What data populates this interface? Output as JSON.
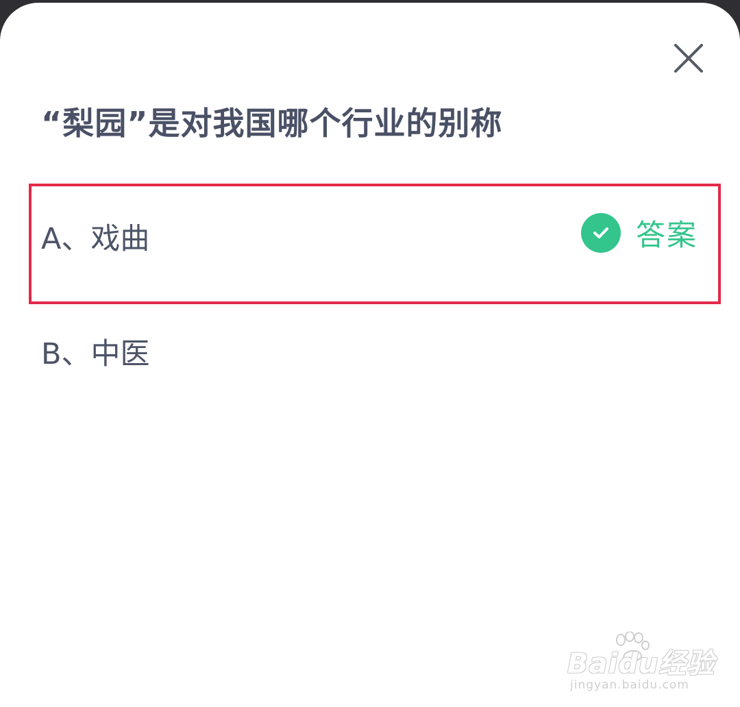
{
  "question": {
    "text": "“梨园”是对我国哪个行业的别称"
  },
  "options": [
    {
      "label": "A、戏曲",
      "is_answer": true
    },
    {
      "label": "B、中医",
      "is_answer": false
    }
  ],
  "answer_badge": {
    "label": "答案",
    "icon": "check-circle-icon"
  },
  "close": {
    "icon": "close-icon"
  },
  "watermark": {
    "brand": "Baidu经验",
    "url": "jingyan.baidu.com",
    "icon": "paw-icon"
  },
  "colors": {
    "question_text": "#4a5166",
    "option_text": "#4d5467",
    "answer_green": "#34c58c",
    "highlight_red": "#e32a49",
    "background": "#ffffff"
  }
}
